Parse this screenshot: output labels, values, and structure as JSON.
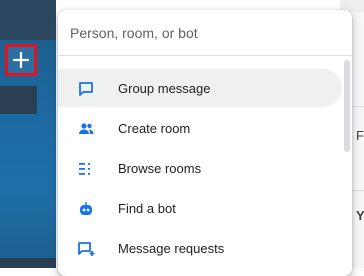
{
  "sidebar": {
    "add_button_icon": "plus-icon"
  },
  "menu": {
    "search_placeholder": "Person, room, or bot",
    "items": [
      {
        "label": "Group message",
        "icon": "chat-bubble-icon"
      },
      {
        "label": "Create room",
        "icon": "people-icon"
      },
      {
        "label": "Browse rooms",
        "icon": "list-icon"
      },
      {
        "label": "Find a bot",
        "icon": "bot-icon"
      },
      {
        "label": "Message requests",
        "icon": "message-add-icon"
      }
    ]
  },
  "background": {
    "letters": [
      "F",
      "Y"
    ]
  },
  "colors": {
    "accent": "#1a73e8",
    "highlight_border": "#e0161e",
    "selected_bg": "#eff1f1"
  }
}
